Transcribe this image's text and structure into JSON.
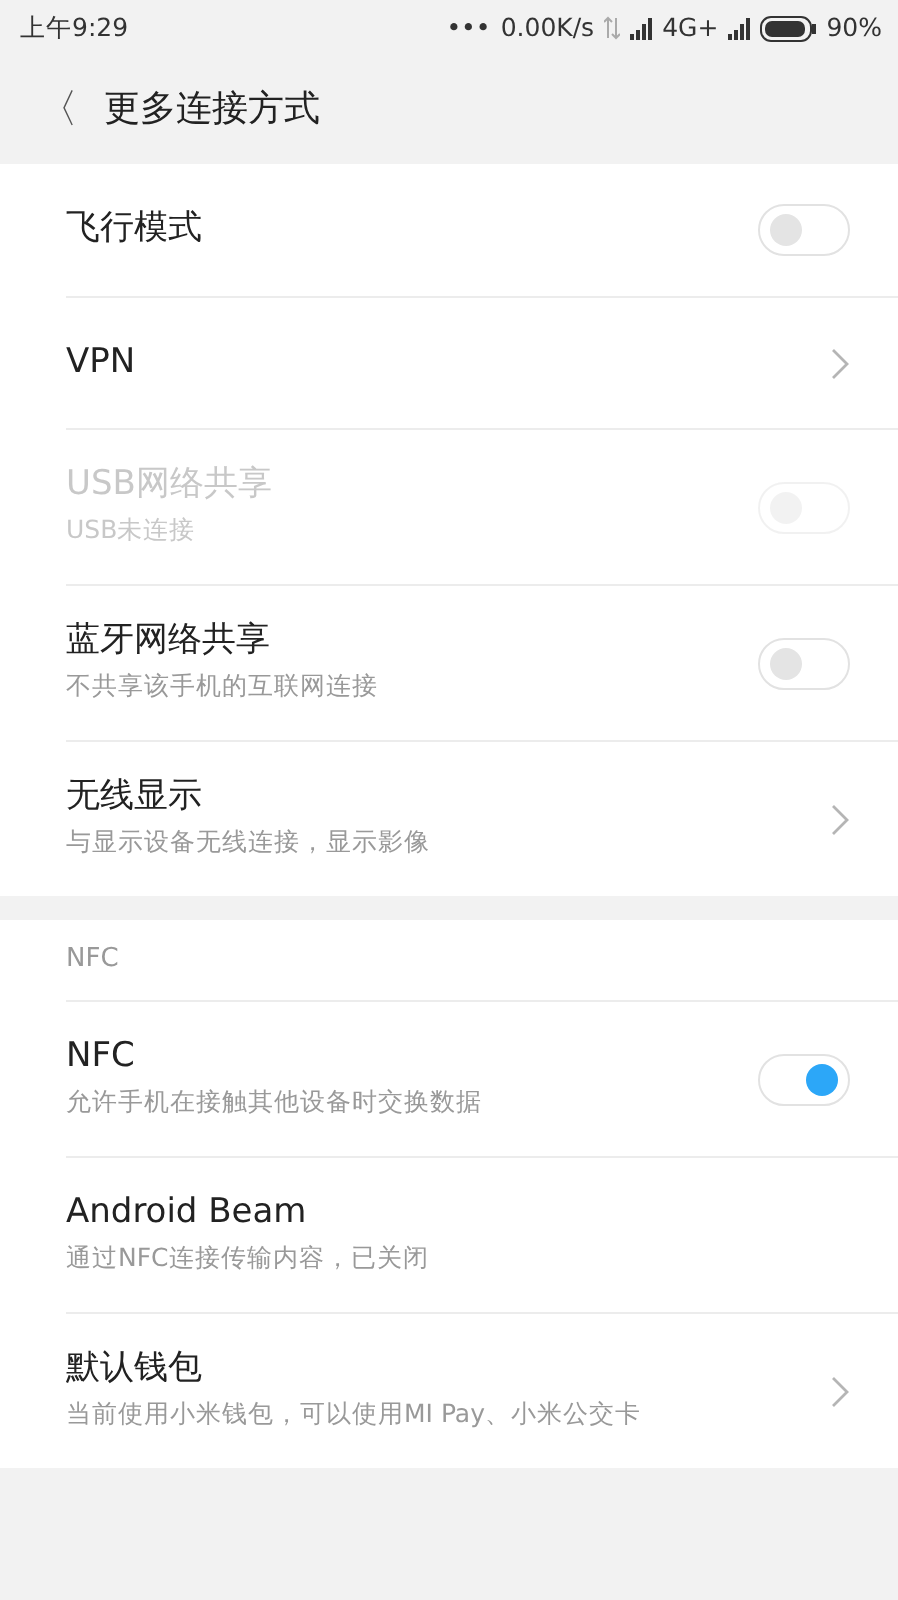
{
  "status_bar": {
    "time": "上午9:29",
    "dots": "•••",
    "speed": "0.00K/s",
    "network": "4G+",
    "battery": "90%"
  },
  "header": {
    "back": "〈",
    "title": "更多连接方式"
  },
  "sections": [
    {
      "items": [
        {
          "kind": "toggle",
          "title": "飞行模式",
          "on": false,
          "disabled": false
        },
        {
          "kind": "arrow",
          "title": "VPN"
        },
        {
          "kind": "toggle",
          "title": "USB网络共享",
          "subtitle": "USB未连接",
          "on": false,
          "disabled": true
        },
        {
          "kind": "toggle",
          "title": "蓝牙网络共享",
          "subtitle": "不共享该手机的互联网连接",
          "on": false,
          "disabled": false
        },
        {
          "kind": "arrow",
          "title": "无线显示",
          "subtitle": "与显示设备无线连接，显示影像"
        }
      ]
    },
    {
      "heading": "NFC",
      "items": [
        {
          "kind": "toggle",
          "title": "NFC",
          "subtitle": "允许手机在接触其他设备时交换数据",
          "on": true,
          "disabled": false
        },
        {
          "kind": "plain",
          "title": "Android Beam",
          "subtitle": "通过NFC连接传输内容，已关闭"
        },
        {
          "kind": "arrow",
          "title": "默认钱包",
          "subtitle": "当前使用小米钱包，可以使用MI Pay、小米公交卡"
        }
      ]
    }
  ]
}
